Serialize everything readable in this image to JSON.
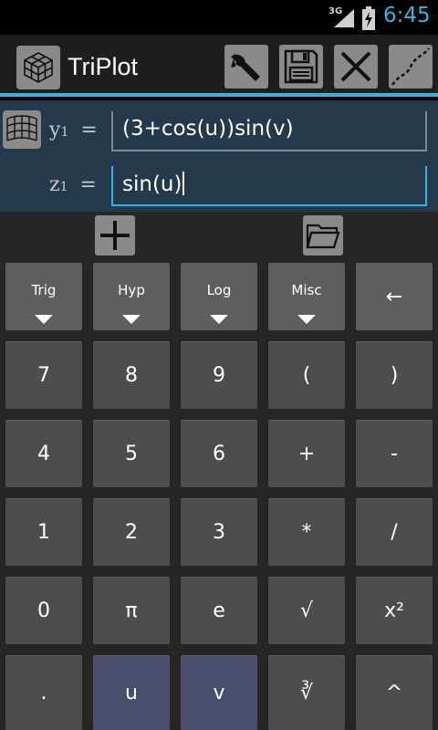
{
  "status": {
    "network": "3G",
    "time": "6:45"
  },
  "app": {
    "title": "TriPlot",
    "accent": "#33b5e5"
  },
  "toolbar_icons": [
    "wrench-icon",
    "save-icon",
    "close-icon",
    "curve-icon"
  ],
  "inputs": {
    "y1": {
      "label_var": "y",
      "label_sub": "1",
      "label_eq": "=",
      "value": "(3+cos(u))sin(v)"
    },
    "z1": {
      "label_var": "z",
      "label_sub": "1",
      "label_eq": "=",
      "value": "sin(u)"
    }
  },
  "keys": {
    "row1": [
      "Trig",
      "Hyp",
      "Log",
      "Misc",
      "←"
    ],
    "row2": [
      "7",
      "8",
      "9",
      "(",
      ")"
    ],
    "row3": [
      "4",
      "5",
      "6",
      "+",
      "-"
    ],
    "row4": [
      "1",
      "2",
      "3",
      "*",
      "/"
    ],
    "row5": [
      "0",
      "π",
      "e",
      "√",
      "x²"
    ],
    "row6": [
      ".",
      "u",
      "v",
      "∛",
      "^"
    ]
  }
}
